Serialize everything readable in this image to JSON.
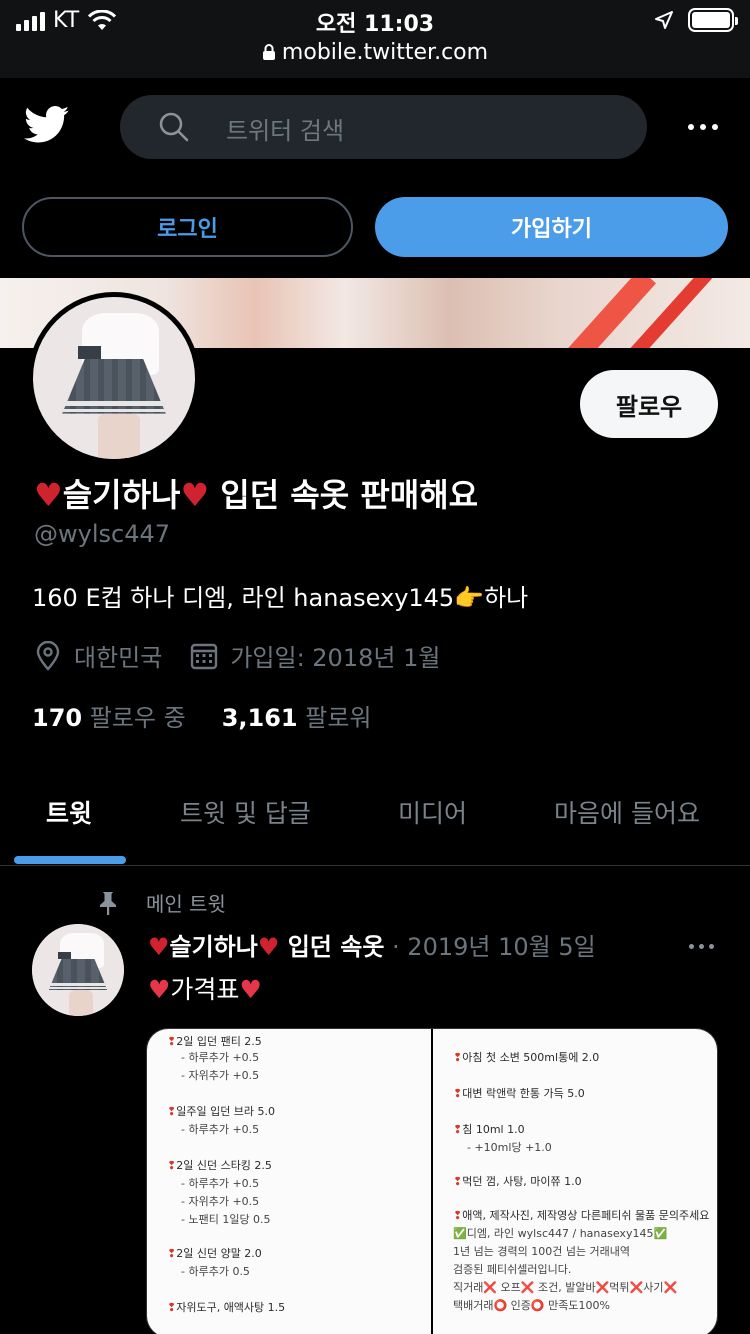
{
  "status_bar": {
    "carrier": "KT",
    "time": "오전 11:03",
    "url": "mobile.twitter.com"
  },
  "header": {
    "search_placeholder": "트위터 검색"
  },
  "auth": {
    "login_label": "로그인",
    "signup_label": "가입하기"
  },
  "profile": {
    "follow_label": "팔로우",
    "name_heart": "♥",
    "name_text": "슬기하나",
    "name_suffix": "입던 속옷 판매해요",
    "handle": "@wylsc447",
    "bio": "160 E컵 하나 디엠, 라인 hanasexy145👉하나",
    "location": "대한민국",
    "joined": "가입일: 2018년 1월",
    "following_count": "170",
    "following_label": "팔로우 중",
    "followers_count": "3,161",
    "followers_label": "팔로워"
  },
  "tabs": [
    {
      "label": "트윗",
      "active": true
    },
    {
      "label": "트윗 및 답글",
      "active": false
    },
    {
      "label": "미디어",
      "active": false
    },
    {
      "label": "마음에 들어요",
      "active": false
    }
  ],
  "tweet": {
    "pinned_label": "메인 트윗",
    "author": "슬기하나",
    "author_suffix": "입던 속옷",
    "date": "· 2019년 10월 5일",
    "text": "가격표",
    "media_left": [
      {
        "text": "2일 입던 팬티 2.5",
        "pin": true
      },
      {
        "text": "-   하루추가 +0.5",
        "pin": false
      },
      {
        "text": "-   자위추가 +0.5",
        "pin": false
      },
      {
        "text": "일주일 입던 브라 5.0",
        "pin": true
      },
      {
        "text": "-   하루추가 +0.5",
        "pin": false
      },
      {
        "text": "2일 신던 스타킹 2.5",
        "pin": true
      },
      {
        "text": "-   하루추가 +0.5",
        "pin": false
      },
      {
        "text": "-   자위추가 +0.5",
        "pin": false
      },
      {
        "text": "-   노팬티 1일당 0.5",
        "pin": false
      },
      {
        "text": "2일 신던 양말 2.0",
        "pin": true
      },
      {
        "text": "-   하루추가 0.5",
        "pin": false
      },
      {
        "text": "자위도구, 애액사탕 1.5",
        "pin": true
      }
    ],
    "media_right": [
      {
        "text": "아침 첫 소변 500ml통에 2.0",
        "pin": true
      },
      {
        "text": "대변 락앤락 한통 가득 5.0",
        "pin": true
      },
      {
        "text": "침 10ml 1.0",
        "pin": true
      },
      {
        "text": "-   +10ml당 +1.0",
        "pin": false
      },
      {
        "text": "먹던 껌, 사탕, 마이쮸 1.0",
        "pin": true
      },
      {
        "text": "애액, 제작사진, 제작영상 다른페티쉬 물품 문의주세요",
        "pin": true
      },
      {
        "text": "✅디엠, 라인 wylsc447 / hanasexy145✅",
        "pin": false
      },
      {
        "text": "1년 넘는 경력의 100건 넘는 거래내역",
        "pin": false
      },
      {
        "text": "검증된 페티쉬셀러입니다.",
        "pin": false
      },
      {
        "text": "직거래❌ 오프❌ 조건, 발알바❌먹튀❌사기❌",
        "pin": false
      },
      {
        "text": "택배거래⭕ 인증⭕ 만족도100%",
        "pin": false
      }
    ]
  },
  "colors": {
    "accent": "#4c9de9",
    "background": "#000000",
    "muted": "#6c757e",
    "heart": "#d1232f"
  }
}
